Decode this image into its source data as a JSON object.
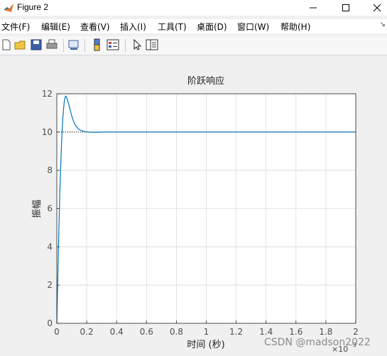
{
  "window": {
    "title": "Figure 2"
  },
  "menu": [
    "文件(F)",
    "编辑(E)",
    "查看(V)",
    "插入(I)",
    "工具(T)",
    "桌面(D)",
    "窗口(W)",
    "帮助(H)"
  ],
  "toolbar": {
    "items": [
      "new-figure",
      "open-file",
      "save",
      "print",
      "link-plot",
      "colorbar",
      "legend",
      "edit-plot",
      "property-inspector"
    ]
  },
  "chart_data": {
    "type": "line",
    "title": "阶跃响应",
    "xlabel": "时间 (秒)",
    "ylabel": "振幅",
    "x_exponent_label": "×10",
    "x_exponent": "-3",
    "xlim": [
      0,
      2
    ],
    "ylim": [
      0,
      12
    ],
    "xticks": [
      "0",
      "0.2",
      "0.4",
      "0.6",
      "0.8",
      "1",
      "1.2",
      "1.4",
      "1.6",
      "1.8",
      "2"
    ],
    "yticks": [
      "0",
      "2",
      "4",
      "6",
      "8",
      "10",
      "12"
    ],
    "grid": true,
    "steady_state": 10,
    "series": [
      {
        "color": "#0072bd",
        "x": [
          0,
          0.005,
          0.01,
          0.015,
          0.02,
          0.025,
          0.03,
          0.035,
          0.04,
          0.045,
          0.05,
          0.055,
          0.06,
          0.065,
          0.07,
          0.08,
          0.09,
          0.1,
          0.11,
          0.12,
          0.13,
          0.14,
          0.15,
          0.17,
          0.19,
          0.21,
          0.23,
          0.25,
          0.28,
          0.31,
          0.35,
          0.4,
          0.5,
          0.6,
          0.8,
          1.0,
          1.5,
          2.0
        ],
        "y": [
          0,
          1.8,
          3.6,
          5.3,
          6.8,
          8.0,
          9.1,
          10.0,
          10.7,
          11.2,
          11.6,
          11.82,
          11.88,
          11.82,
          11.7,
          11.45,
          11.15,
          10.85,
          10.6,
          10.42,
          10.3,
          10.2,
          10.13,
          10.06,
          10.02,
          10.0,
          9.99,
          9.99,
          9.995,
          10.0,
          10.0,
          10.0,
          10.0,
          10.0,
          10.0,
          10.0,
          10.0,
          10.0
        ]
      }
    ]
  },
  "watermark": "CSDN @madson2022"
}
